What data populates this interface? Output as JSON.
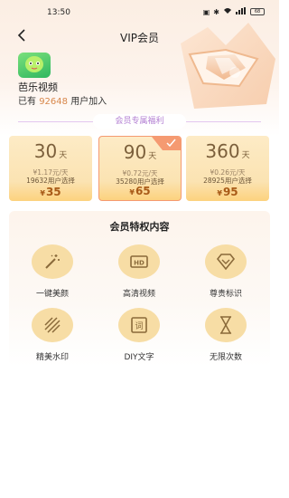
{
  "status": {
    "time": "13:50",
    "battery": "68"
  },
  "nav": {
    "title": "VIP会员"
  },
  "app": {
    "name": "芭乐视频",
    "logo_text": "芭乐视频",
    "count_prefix": "已有",
    "count": "92648",
    "count_suffix": "用户加入"
  },
  "section": {
    "label": "会员专属福利"
  },
  "plans": [
    {
      "days": "30",
      "unit": "天",
      "per_day": "¥1.17元/天",
      "users": "19632用户选择",
      "currency": "¥",
      "price": "35",
      "selected": false
    },
    {
      "days": "90",
      "unit": "天",
      "per_day": "¥0.72元/天",
      "users": "35280用户选择",
      "currency": "¥",
      "price": "65",
      "selected": true
    },
    {
      "days": "360",
      "unit": "天",
      "per_day": "¥0.26元/天",
      "users": "28925用户选择",
      "currency": "¥",
      "price": "95",
      "selected": false
    }
  ],
  "benefits": {
    "title": "会员特权内容",
    "items": [
      {
        "label": "一键美颜",
        "icon": "magic-wand-icon"
      },
      {
        "label": "高清视频",
        "icon": "hd-icon"
      },
      {
        "label": "尊贵标识",
        "icon": "diamond-icon"
      },
      {
        "label": "精美水印",
        "icon": "watermark-icon"
      },
      {
        "label": "DIY文字",
        "icon": "text-box-icon"
      },
      {
        "label": "无限次数",
        "icon": "hourglass-icon"
      }
    ]
  },
  "colors": {
    "accent": "#d8874b",
    "plan_border": "#f59a71",
    "price": "#a85a17",
    "icon_bg": "#f7dda5",
    "section_label": "#b27ed2"
  }
}
